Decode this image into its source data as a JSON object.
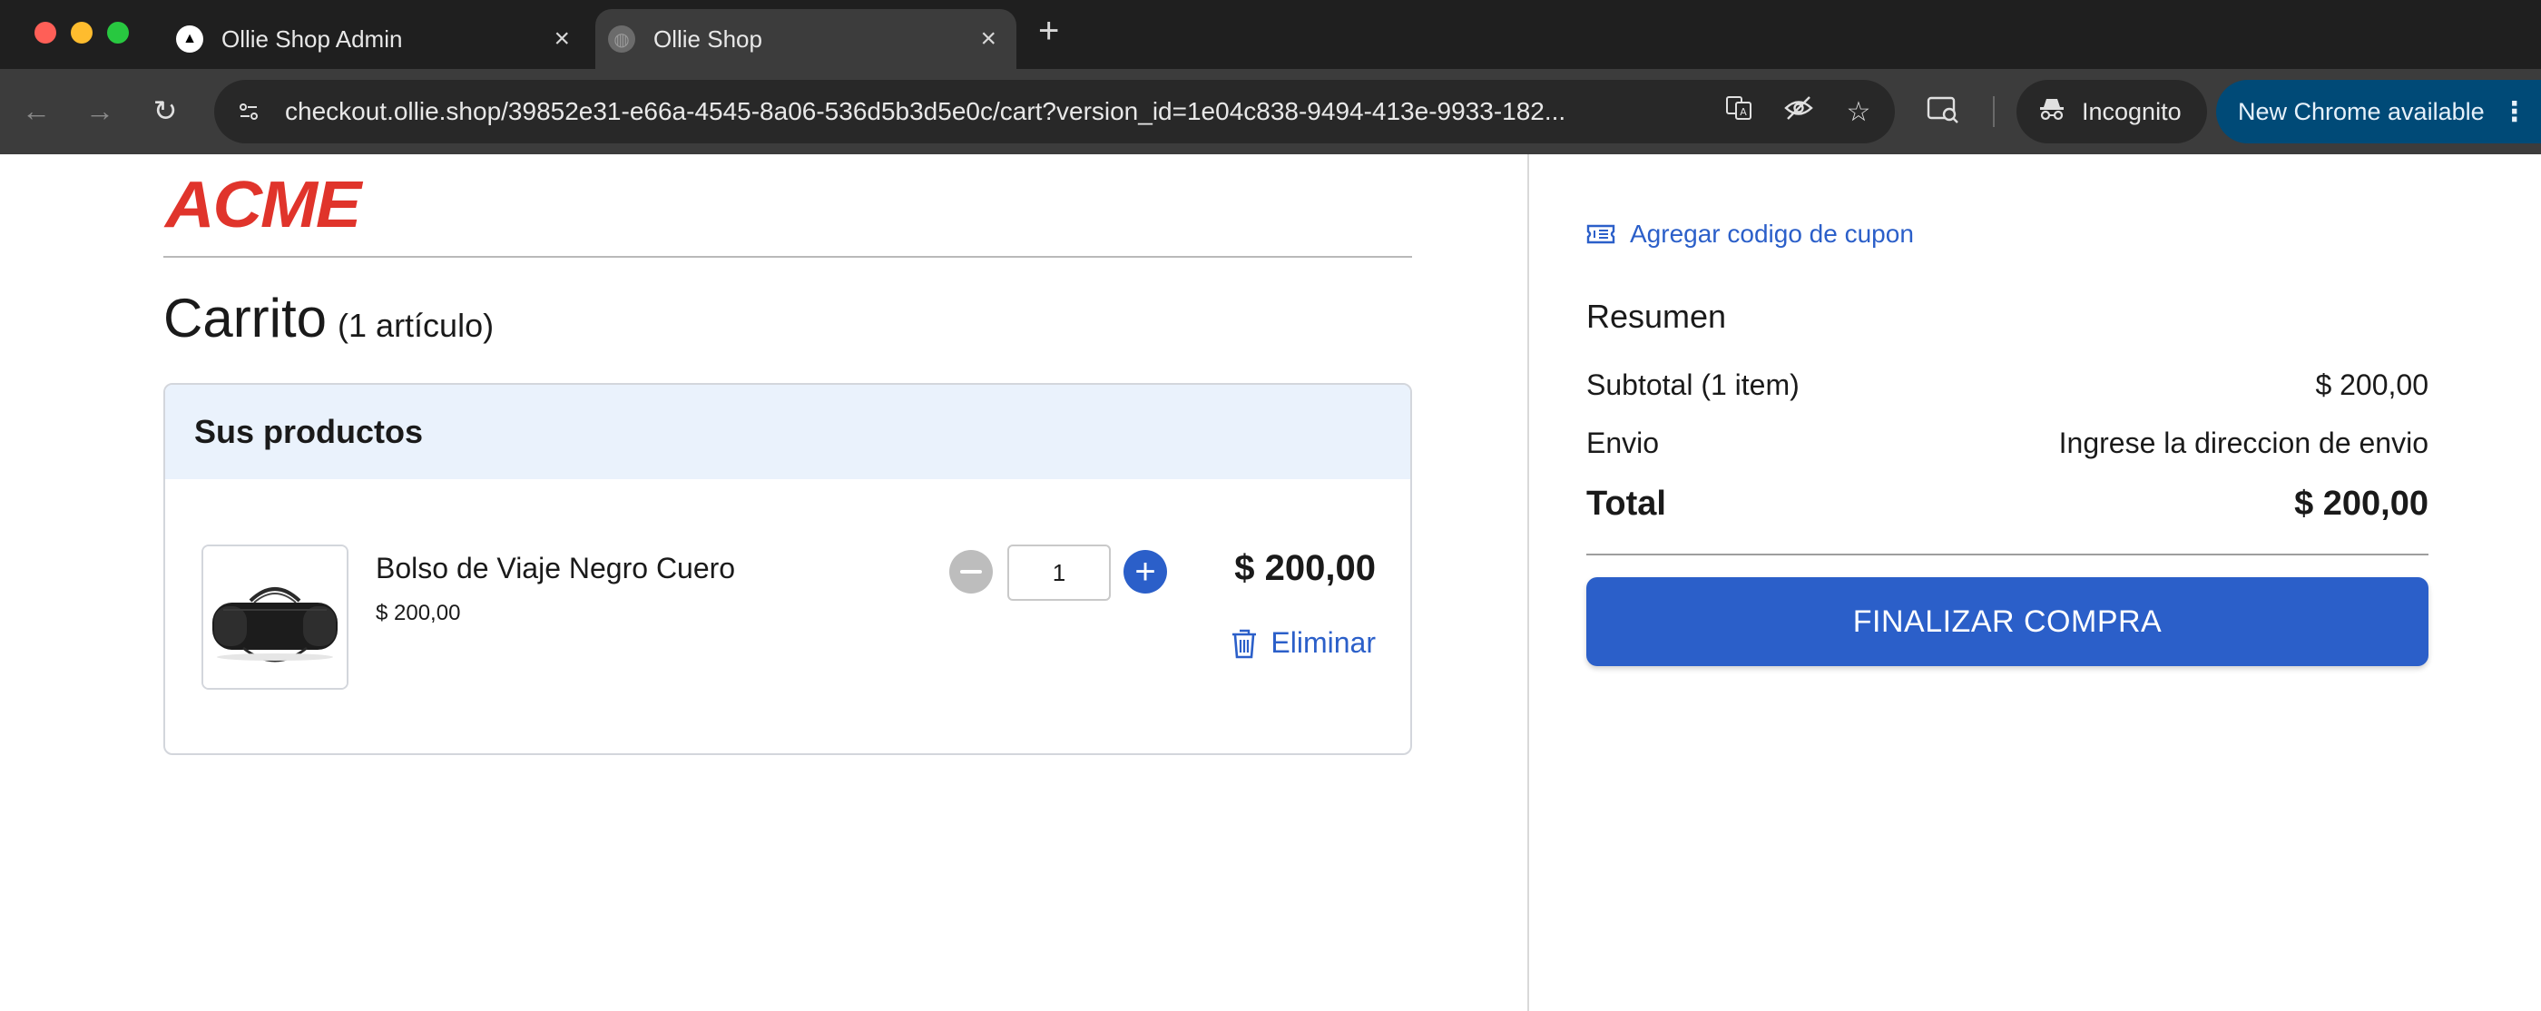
{
  "browser": {
    "tabs": [
      {
        "title": "Ollie Shop Admin",
        "favicon": "vercel-triangle-icon",
        "active": false
      },
      {
        "title": "Ollie Shop",
        "favicon": "globe-icon",
        "active": true
      }
    ],
    "url": "checkout.ollie.shop/39852e31-e66a-4545-8a06-536d5b3d5e0c/cart?version_id=1e04c838-9494-413e-9933-182...",
    "incognito_label": "Incognito",
    "update_label": "New Chrome available"
  },
  "brand": {
    "logo_text": "ACME",
    "logo_color": "#e0342b"
  },
  "cart": {
    "title": "Carrito",
    "count_label": "(1 artículo)",
    "products_header": "Sus productos",
    "items": [
      {
        "name": "Bolso de Viaje Negro Cuero",
        "unit_price": "$ 200,00",
        "quantity": "1",
        "line_total": "$ 200,00",
        "remove_label": "Eliminar"
      }
    ]
  },
  "summary": {
    "coupon_label": "Agregar codigo de cupon",
    "title": "Resumen",
    "subtotal_label": "Subtotal (1 item)",
    "subtotal_value": "$ 200,00",
    "shipping_label": "Envio",
    "shipping_value": "Ingrese la direccion de envio",
    "total_label": "Total",
    "total_value": "$ 200,00",
    "checkout_label": "FINALIZAR COMPRA"
  },
  "colors": {
    "accent": "#2b5fc9",
    "header_bg": "#eaf2fc"
  }
}
